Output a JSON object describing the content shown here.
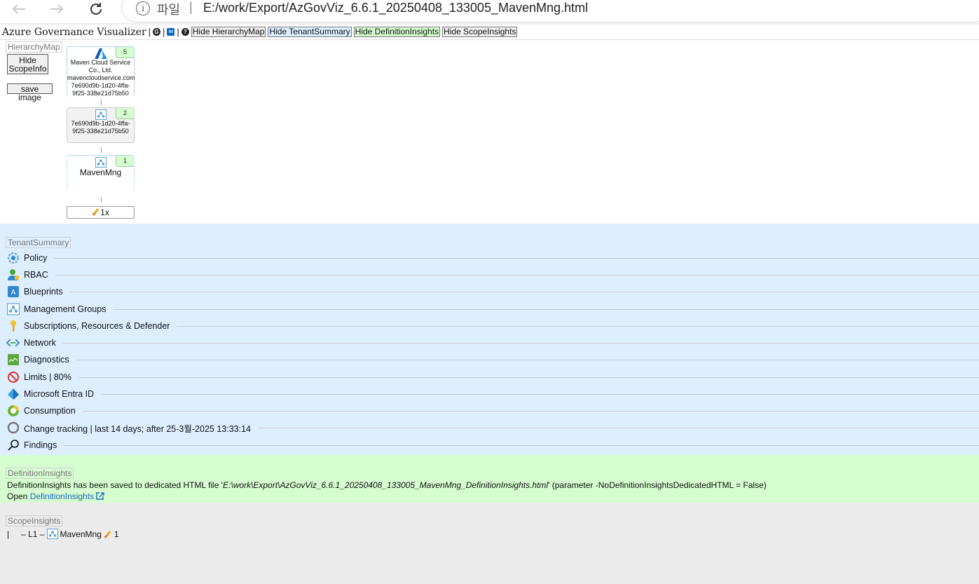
{
  "browser": {
    "address_label": "파일",
    "address_separator": "|",
    "url": "E:/work/Export/AzGovViz_6.6.1_20250408_133005_MavenMng.html"
  },
  "topbar": {
    "brand": "Azure Governance Visualizer",
    "sep": "|",
    "buttons": {
      "hide_hierarchy": "Hide HierarchyMap",
      "hide_tenant": "Hide TenantSummary",
      "hide_definition": "Hide DefinitionInsights",
      "hide_scope": "Hide ScopeInsights"
    }
  },
  "hierarchy": {
    "label": "HierarchyMap",
    "hide_scopeinfo": "Hide ScopeInfo",
    "save_image": "save image",
    "nodes": [
      {
        "badge": "5",
        "line1": "Maven Cloud Service",
        "line2": "Co., Ltd.",
        "line3": "mavencloudservice.com",
        "line4": "7e690d9b-1d20-4ffa-",
        "line5": "9f25-338e21d75b50"
      },
      {
        "badge": "2",
        "line1": "7e690d9b-1d20-4ffa-",
        "line2": "9f25-338e21d75b50"
      },
      {
        "badge": "1",
        "name": "MavenMng"
      }
    ],
    "sub_count": "1x"
  },
  "tenant": {
    "label": "TenantSummary",
    "items": [
      {
        "label": "Policy",
        "icon": "policy-icon"
      },
      {
        "label": "RBAC",
        "icon": "rbac-icon"
      },
      {
        "label": "Blueprints",
        "icon": "blueprints-icon"
      },
      {
        "label": "Management Groups",
        "icon": "management-groups-icon"
      },
      {
        "label": "Subscriptions, Resources & Defender",
        "icon": "key-icon"
      },
      {
        "label": "Network",
        "icon": "network-icon"
      },
      {
        "label": "Diagnostics",
        "icon": "diagnostics-icon"
      },
      {
        "label": "Limits | 80%",
        "icon": "limits-icon"
      },
      {
        "label": "Microsoft Entra ID",
        "icon": "entra-icon"
      },
      {
        "label": "Consumption",
        "icon": "consumption-icon"
      },
      {
        "label": "Change tracking | last 14 days; after 25-3월-2025 13:33:14",
        "icon": "change-tracking-icon"
      },
      {
        "label": "Findings",
        "icon": "search-icon"
      }
    ]
  },
  "definition": {
    "label": "DefinitionInsights",
    "text_prefix": "DefinitionInsights has been saved to dedicated HTML file '",
    "file": "E:\\work\\Export\\AzGovViz_6.6.1_20250408_133005_MavenMng_DefinitionInsights.html",
    "text_suffix": "' (parameter -NoDefinitionInsightsDedicatedHTML = False)",
    "open_prefix": "Open",
    "open_link": "DefinitionInsights"
  },
  "scope": {
    "label": "ScopeInsights",
    "bar": "|",
    "level": "– L1 –",
    "name": "MavenMng",
    "count": "1"
  },
  "colors": {
    "tenant_bg": "#ddefff",
    "definition_bg": "#d6fdd0",
    "scope_bg": "#ebebeb",
    "link": "#1a66c2"
  }
}
